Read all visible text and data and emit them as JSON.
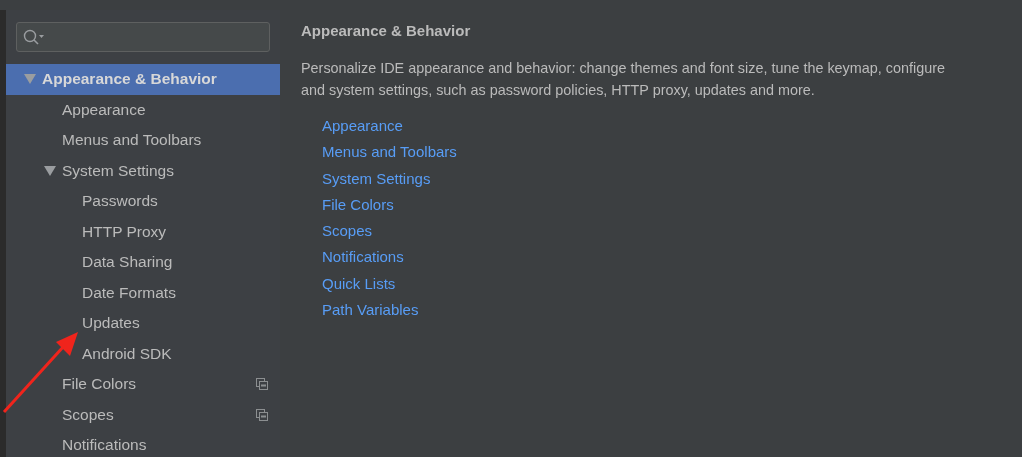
{
  "tree": [
    {
      "label": "Appearance & Behavior",
      "selected": true,
      "expanded": true,
      "shared": false,
      "children": [
        {
          "label": "Appearance",
          "selected": false,
          "shared": false
        },
        {
          "label": "Menus and Toolbars",
          "selected": false,
          "shared": false
        },
        {
          "label": "System Settings",
          "selected": false,
          "expanded": true,
          "shared": false,
          "children": [
            {
              "label": "Passwords",
              "selected": false,
              "shared": false
            },
            {
              "label": "HTTP Proxy",
              "selected": false,
              "shared": false
            },
            {
              "label": "Data Sharing",
              "selected": false,
              "shared": false
            },
            {
              "label": "Date Formats",
              "selected": false,
              "shared": false
            },
            {
              "label": "Updates",
              "selected": false,
              "shared": false
            },
            {
              "label": "Android SDK",
              "selected": false,
              "shared": false
            }
          ]
        },
        {
          "label": "File Colors",
          "selected": false,
          "shared": true
        },
        {
          "label": "Scopes",
          "selected": false,
          "shared": true
        },
        {
          "label": "Notifications",
          "selected": false,
          "shared": false
        }
      ]
    }
  ],
  "content": {
    "title": "Appearance & Behavior",
    "description_lines": [
      "Personalize IDE appearance and behavior: change themes and font size, tune the keymap, configure",
      "and system settings, such as password policies, HTTP proxy, updates and more."
    ],
    "links": [
      "Appearance",
      "Menus and Toolbars",
      "System Settings",
      "File Colors",
      "Scopes",
      "Notifications",
      "Quick Lists",
      "Path Variables"
    ]
  }
}
